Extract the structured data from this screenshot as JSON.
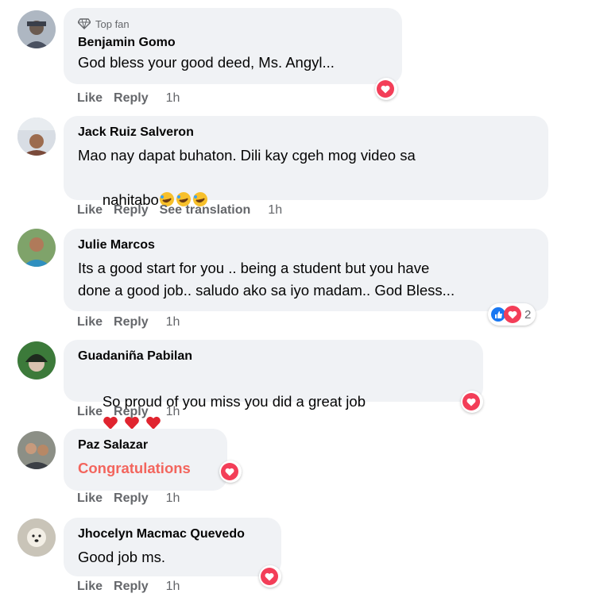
{
  "comments": [
    {
      "badge": "Top fan",
      "name": "Benjamin Gomo",
      "text": "God bless your good deed, Ms. Angyl...",
      "actions": {
        "like": "Like",
        "reply": "Reply",
        "time": "1h"
      },
      "reactions": [
        "heart"
      ]
    },
    {
      "name": "Jack Ruiz Salveron",
      "line1": "Mao nay dapat buhaton. Dili kay cgeh mog video sa",
      "line2": "nahitabo",
      "emojis": [
        "rolling-laughing",
        "rolling-laughing",
        "rolling-laughing"
      ],
      "actions": {
        "like": "Like",
        "reply": "Reply",
        "translate": "See translation",
        "time": "1h"
      }
    },
    {
      "name": "Julie Marcos",
      "line1": "Its a good start for you .. being a student but you have",
      "line2": "done a good job.. saludo ako sa iyo madam.. God Bless...",
      "actions": {
        "like": "Like",
        "reply": "Reply",
        "time": "1h"
      },
      "reactions": [
        "like",
        "heart"
      ],
      "reaction_count": "2"
    },
    {
      "name": "Guadaniña Pabilan",
      "text": "So proud of you miss you did a great job",
      "emojis": [
        "red-heart",
        "red-heart",
        "red-heart"
      ],
      "actions": {
        "like": "Like",
        "reply": "Reply",
        "time": "1h"
      },
      "reactions": [
        "heart"
      ]
    },
    {
      "name": "Paz Salazar",
      "text": "Congratulations",
      "actions": {
        "like": "Like",
        "reply": "Reply",
        "time": "1h"
      },
      "reactions": [
        "heart"
      ]
    },
    {
      "name": "Jhocelyn Macmac Quevedo",
      "text": "Good job ms.",
      "actions": {
        "like": "Like",
        "reply": "Reply",
        "time": "1h"
      },
      "reactions": [
        "heart"
      ]
    }
  ],
  "colors": {
    "bubble": "#f0f2f5",
    "heart": "#f33e58",
    "like": "#1877f2",
    "muted": "#65676b",
    "congrats": "#f3655d"
  }
}
